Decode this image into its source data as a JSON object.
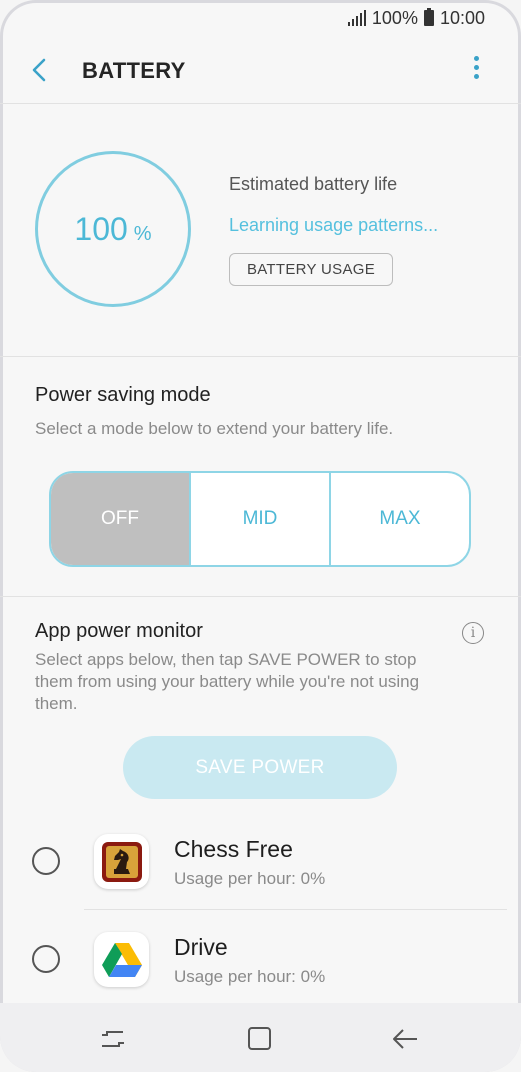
{
  "status_bar": {
    "signal_icon": "signal-icon",
    "battery_percent": "100%",
    "time": "10:00"
  },
  "app_bar": {
    "title": "BATTERY",
    "back_icon": "back-arrow-icon",
    "more_icon": "more-vert-icon"
  },
  "battery": {
    "level": "100",
    "percent_sign": "%",
    "estimated_label": "Estimated battery life",
    "learning_text": "Learning usage patterns...",
    "usage_button": "BATTERY USAGE"
  },
  "power_saving": {
    "title": "Power saving mode",
    "subtitle": "Select a mode below to extend your battery life.",
    "modes": [
      "OFF",
      "MID",
      "MAX"
    ],
    "selected": "OFF"
  },
  "app_power_monitor": {
    "title": "App power monitor",
    "description_lines": [
      "Select apps below, then tap SAVE POWER to stop",
      "them from using your battery while you're not using",
      "them."
    ],
    "save_button": "SAVE POWER",
    "apps": [
      {
        "name": "Chess Free",
        "usage": "Usage per hour: 0%",
        "icon": "chess-knight-icon"
      },
      {
        "name": "Drive",
        "usage": "Usage per hour: 0%",
        "icon": "google-drive-icon"
      }
    ]
  },
  "colors": {
    "accent": "#4cb8d6",
    "ring": "#80cde0",
    "segment_border": "#8ed5e6",
    "segment_active_bg": "#bfbfbf",
    "save_button_bg": "#c9e9f1"
  },
  "nav_bar": {
    "icons": [
      "recent-apps-icon",
      "home-icon",
      "back-icon"
    ]
  }
}
